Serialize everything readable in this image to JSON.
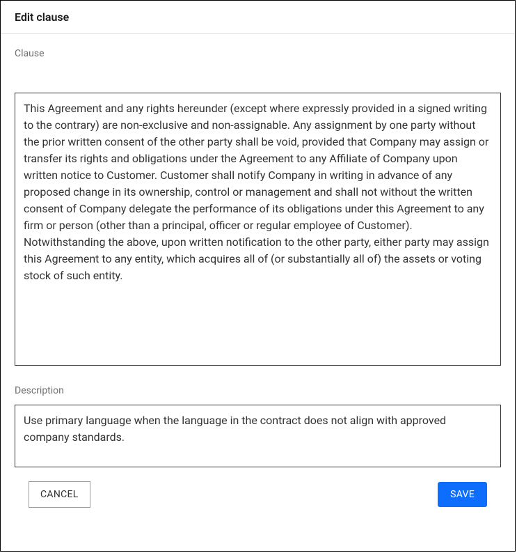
{
  "dialog": {
    "title": "Edit clause",
    "clause": {
      "label": "Clause",
      "value": "This Agreement and any rights hereunder (except where expressly provided in a signed writing to the contrary) are non-exclusive and non-assignable. Any assignment by one party without the prior written consent of the other party shall be void, provided that Company may assign or transfer its rights and obligations under the Agreement to any Affiliate of Company upon written notice to Customer. Customer shall notify Company in writing in advance of any proposed change in its ownership, control or management and shall not without the written consent of Company delegate the performance of its obligations under this Agreement to any firm or person (other than a principal, officer or regular employee of Customer). Notwithstanding the above, upon written notification to the other party, either party may assign this Agreement to any entity, which acquires all of (or substantially all of) the assets or voting stock of such entity."
    },
    "description": {
      "label": "Description",
      "value": "Use primary language when the language in the contract does not align with approved company standards."
    },
    "buttons": {
      "cancel": "CANCEL",
      "save": "SAVE"
    }
  }
}
